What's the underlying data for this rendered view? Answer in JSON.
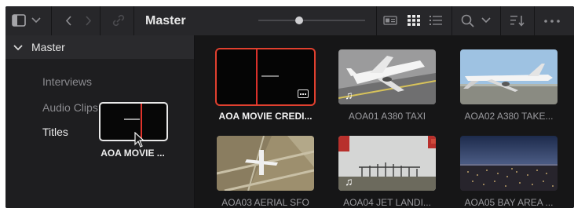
{
  "toolbar": {
    "title": "Master",
    "icons": [
      "sidebar-toggle-icon",
      "chevron-down-icon",
      "back-icon",
      "forward-icon",
      "link-icon",
      "metadata-view-icon",
      "thumbnail-view-icon",
      "list-view-icon",
      "search-icon",
      "chevron-down-icon",
      "sort-icon",
      "more-icon"
    ],
    "zoom_level": 0.38
  },
  "sidebar": {
    "header": "Master",
    "items": [
      {
        "label": "Interviews",
        "active": false
      },
      {
        "label": "Audio Clips",
        "active": false
      },
      {
        "label": "Titles",
        "active": true
      }
    ]
  },
  "drag": {
    "label": "AOA MOVIE ..."
  },
  "clips": [
    {
      "label": "AOA MOVIE CREDI...",
      "selected": true
    },
    {
      "label": "AOA01 A380 TAXI",
      "selected": false
    },
    {
      "label": "AOA02 A380 TAKE...",
      "selected": false
    },
    {
      "label": "AOA03 AERIAL SFO",
      "selected": false
    },
    {
      "label": "AOA04 JET LANDI...",
      "selected": false
    },
    {
      "label": "AOA05 BAY AREA ...",
      "selected": false
    }
  ],
  "colors": {
    "selection": "#e0402f",
    "background": "#1c1c1e"
  }
}
